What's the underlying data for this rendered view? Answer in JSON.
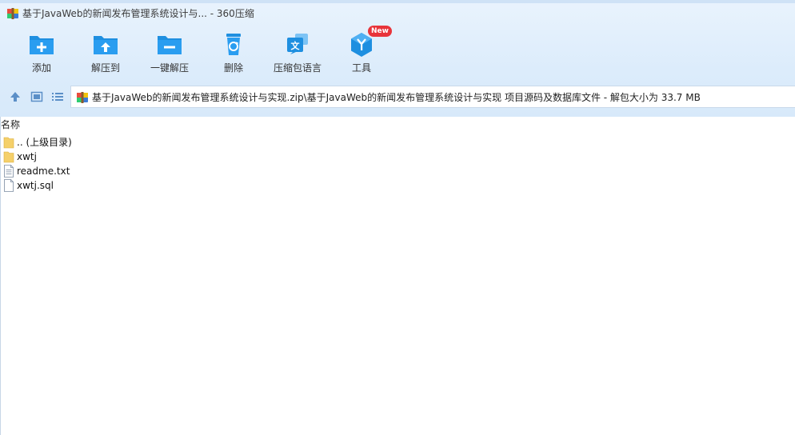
{
  "window": {
    "title": "基于JavaWeb的新闻发布管理系统设计与... - 360压缩"
  },
  "toolbar": {
    "buttons": [
      {
        "label": "添加",
        "icon": "add-folder-icon"
      },
      {
        "label": "解压到",
        "icon": "extract-to-icon"
      },
      {
        "label": "一键解压",
        "icon": "one-click-extract-icon"
      },
      {
        "label": "删除",
        "icon": "recycle-bin-icon"
      },
      {
        "label": "压缩包语言",
        "icon": "language-icon"
      },
      {
        "label": "工具",
        "icon": "tools-icon",
        "badge": "New"
      }
    ]
  },
  "nav": {
    "icons": [
      "up-arrow-icon",
      "view-icon",
      "list-view-icon"
    ]
  },
  "address": {
    "path": "基于JavaWeb的新闻发布管理系统设计与实现.zip\\基于JavaWeb的新闻发布管理系统设计与实现 项目源码及数据库文件 - 解包大小为 33.7 MB"
  },
  "list": {
    "header": "名称",
    "items": [
      {
        "name": ".. (上级目录)",
        "type": "folder"
      },
      {
        "name": "xwtj",
        "type": "folder"
      },
      {
        "name": "readme.txt",
        "type": "file"
      },
      {
        "name": "xwtj.sql",
        "type": "file"
      }
    ]
  },
  "colors": {
    "accent": "#1e8fe0",
    "badge": "#e8343a",
    "folder": "#f5d06a"
  }
}
